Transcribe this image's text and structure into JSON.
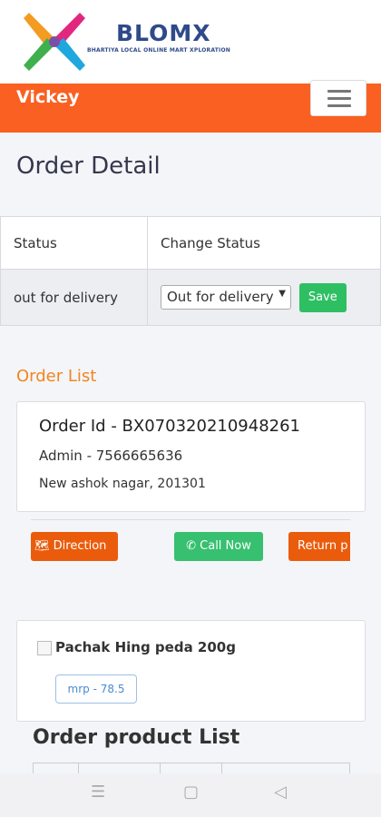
{
  "brand": {
    "name": "BLOMX",
    "tagline": "BHARTIYA LOCAL ONLINE MART XPLORATION",
    "logo_colors": [
      "#f49b22",
      "#e2277f",
      "#3fb04b",
      "#1fa7de"
    ]
  },
  "header": {
    "user": "Vickey",
    "menu_icon": "hamburger-icon",
    "color": "#fa6021"
  },
  "page": {
    "title": "Order Detail"
  },
  "status_table": {
    "headers": [
      "Status",
      "Change Status"
    ],
    "current_status": "out for delivery",
    "selected_option": "Out for delivery",
    "save_label": "Save"
  },
  "order_list": {
    "label": "Order List",
    "order_id": "Order Id - BX070320210948261",
    "customer": "Admin - 7566665636",
    "address": "New ashok nagar, 201301"
  },
  "actions": {
    "direction": "Direction",
    "call": "Call Now",
    "return": "Return p",
    "direction_icon": "map-icon",
    "call_icon": "phone-icon"
  },
  "product": {
    "name": "Pachak Hing peda 200g",
    "mrp": "mrp - 78.5",
    "image_icon": "broken-image-icon"
  },
  "product_list": {
    "title": "Order product List"
  },
  "system_nav": {
    "items": [
      "recent-apps-icon",
      "home-icon",
      "back-icon"
    ]
  }
}
